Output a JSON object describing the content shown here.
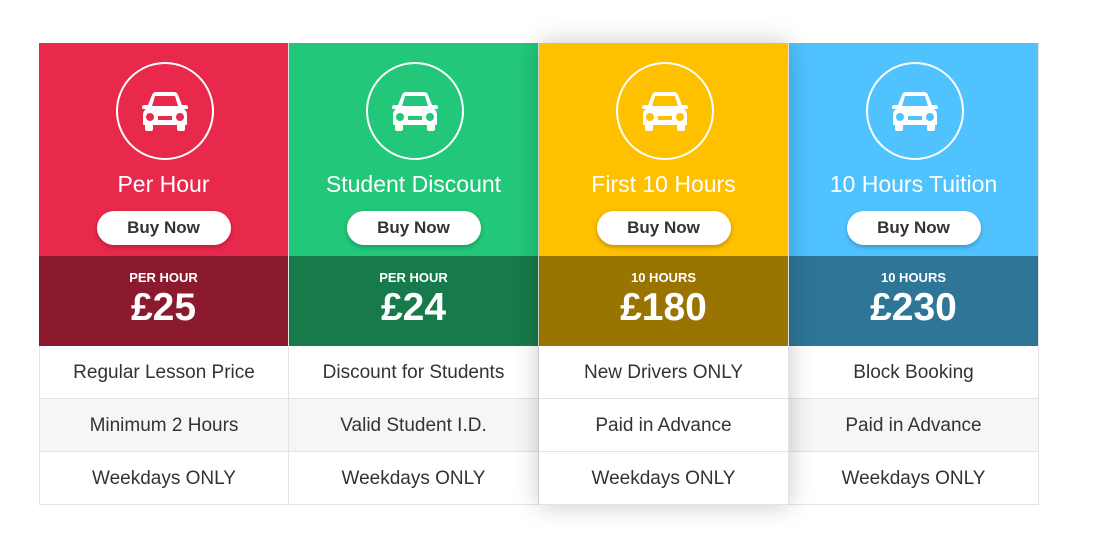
{
  "plans": [
    {
      "title": "Per Hour",
      "button_label": "Buy Now",
      "price_label": "PER HOUR",
      "price": "£25",
      "features": [
        "Regular Lesson Price",
        "Minimum 2 Hours",
        "Weekdays ONLY"
      ],
      "head_color": "#e8294c",
      "band_color": "#8b1a2e",
      "icon": "car-icon"
    },
    {
      "title": "Student Discount",
      "button_label": "Buy Now",
      "price_label": "PER HOUR",
      "price": "£24",
      "features": [
        "Discount for Students",
        "Valid Student I.D.",
        "Weekdays ONLY"
      ],
      "head_color": "#22c77a",
      "band_color": "#177a4b",
      "icon": "car-icon"
    },
    {
      "title": "First 10 Hours",
      "button_label": "Buy Now",
      "price_label": "10 HOURS",
      "price": "£180",
      "features": [
        "New Drivers ONLY",
        "Paid in Advance",
        "Weekdays ONLY"
      ],
      "head_color": "#ffc000",
      "band_color": "#9a7400",
      "icon": "car-icon"
    },
    {
      "title": "10 Hours Tuition",
      "button_label": "Buy Now",
      "price_label": "10 HOURS",
      "price": "£230",
      "features": [
        "Block Booking",
        "Paid in Advance",
        "Weekdays ONLY"
      ],
      "head_color": "#50c3ff",
      "band_color": "#2e7598",
      "icon": "car-icon"
    }
  ]
}
